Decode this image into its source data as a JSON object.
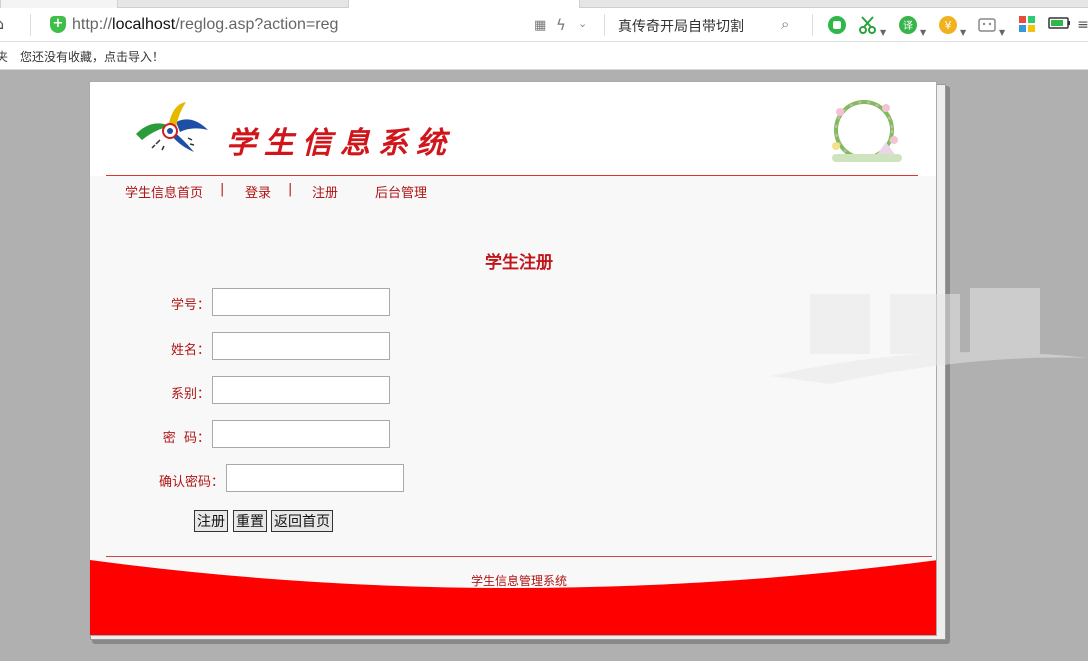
{
  "browser": {
    "url_prefix": "http://",
    "url_host": "localhost",
    "url_path": "/reglog.asp?action=reg",
    "search_text": "真传奇开局自带切割",
    "bookmark_hint": "您还没有收藏，点击导入！",
    "bookmark_left": "夹"
  },
  "site": {
    "title": "学生信息系统",
    "nav": {
      "home": "学生信息首页",
      "login": "登录",
      "register": "注册",
      "admin": "后台管理",
      "sep": "|"
    },
    "form": {
      "title": "学生注册",
      "student_id_label": "学号：",
      "name_label": "姓名：",
      "department_label": "系别：",
      "password_label": "密  码：",
      "confirm_label": "确认密码：",
      "student_id_value": "",
      "name_value": "",
      "department_value": "",
      "password_value": "",
      "confirm_value": "",
      "submit_label": "注册",
      "reset_label": "重置",
      "back_label": "返回首页"
    },
    "footer": "学生信息管理系统"
  },
  "colors": {
    "accent_red": "#d0161a",
    "footer_red": "#ff0000"
  }
}
